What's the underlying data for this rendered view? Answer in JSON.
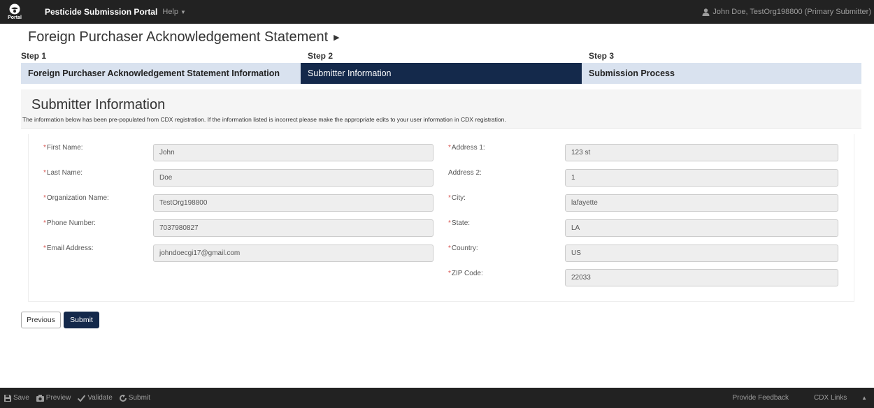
{
  "navbar": {
    "logo_text": "Portal",
    "brand": "Pesticide Submission Portal",
    "help": "Help",
    "user": "John Doe, TestOrg198800 (Primary Submitter)"
  },
  "page": {
    "title": "Foreign Purchaser Acknowledgement Statement"
  },
  "steps": [
    {
      "label": "Step 1",
      "name": "Foreign Purchaser Acknowledgement Statement Information",
      "active": false
    },
    {
      "label": "Step 2",
      "name": "Submitter Information",
      "active": true
    },
    {
      "label": "Step 3",
      "name": "Submission Process",
      "active": false
    }
  ],
  "panel": {
    "heading": "Submitter Information",
    "note": "The information below has been pre-populated from CDX registration. If the information listed is incorrect please make the appropriate edits to your user information in CDX registration."
  },
  "form": {
    "first_name": {
      "label": "First Name:",
      "value": "John",
      "required": true
    },
    "last_name": {
      "label": "Last Name:",
      "value": "Doe",
      "required": true
    },
    "organization": {
      "label": "Organization Name:",
      "value": "TestOrg198800",
      "required": true
    },
    "phone": {
      "label": "Phone Number:",
      "value": "7037980827",
      "required": true
    },
    "email": {
      "label": "Email Address:",
      "value": "johndoecgi17@gmail.com",
      "required": true
    },
    "address1": {
      "label": "Address 1:",
      "value": "123 st",
      "required": true
    },
    "address2": {
      "label": "Address 2:",
      "value": "1",
      "required": false
    },
    "city": {
      "label": "City:",
      "value": "lafayette",
      "required": true
    },
    "state": {
      "label": "State:",
      "value": "LA",
      "required": true
    },
    "country": {
      "label": "Country:",
      "value": "US",
      "required": true
    },
    "zip": {
      "label": "ZIP Code:",
      "value": "22033",
      "required": true
    }
  },
  "buttons": {
    "previous": "Previous",
    "submit": "Submit"
  },
  "toolbar": {
    "save": "Save",
    "preview": "Preview",
    "validate": "Validate",
    "submit": "Submit",
    "feedback": "Provide Feedback",
    "cdx_links": "CDX Links"
  },
  "colors": {
    "navbar": "#222222",
    "step_active": "#14294b",
    "step_bar": "#d9e2ef",
    "required": "#d9534f"
  }
}
